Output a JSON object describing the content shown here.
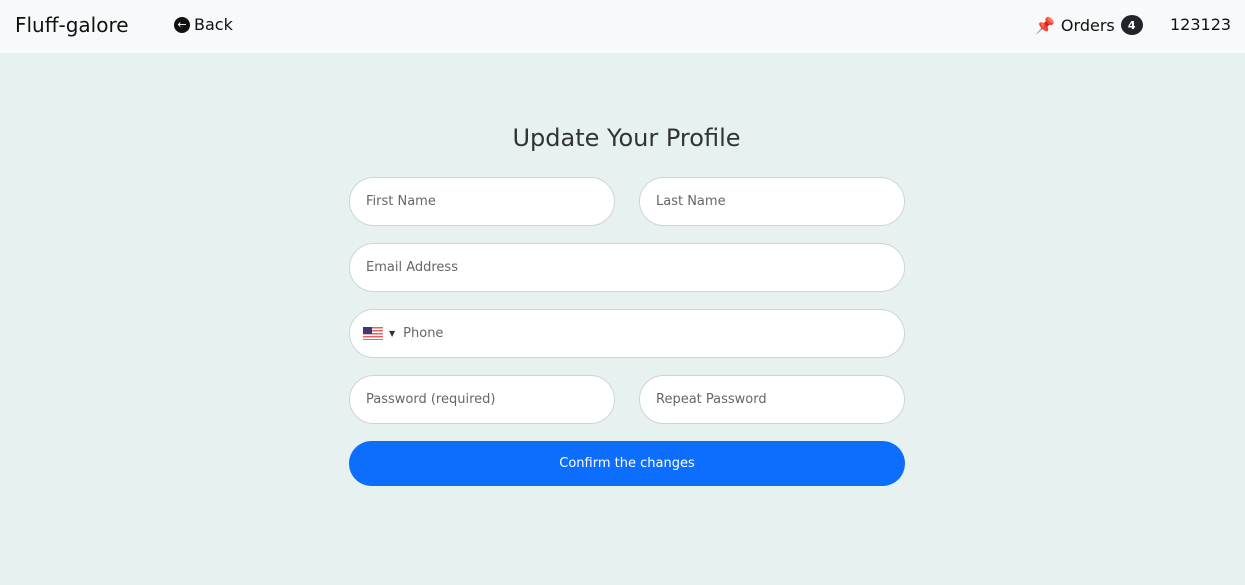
{
  "nav": {
    "brand": "Fluff-galore",
    "back": "Back",
    "orders": "Orders",
    "orders_count": "4",
    "user": "123123"
  },
  "form": {
    "title": "Update Your Profile",
    "first_name": "First Name",
    "last_name": "Last Name",
    "email": "Email Address",
    "phone_country": "US",
    "phone": "Phone",
    "password": "Password (required)",
    "repeat_password": "Repeat Password",
    "submit": "Confirm the changes"
  }
}
